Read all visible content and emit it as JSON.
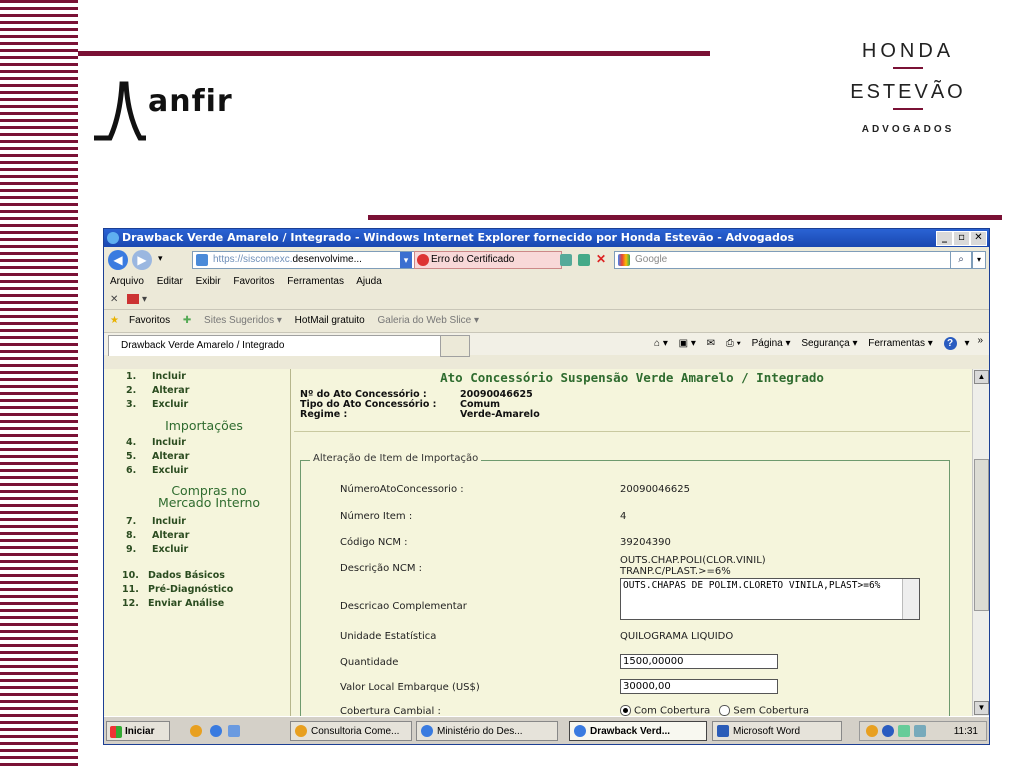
{
  "slide": {
    "logo_left": "anfir",
    "logo_right": {
      "line1": "HONDA",
      "line2": "ESTEVÃO",
      "line3": "ADVOGADOS"
    }
  },
  "window": {
    "title": "Drawback Verde Amarelo / Integrado - Windows Internet Explorer fornecido por Honda Estevão - Advogados",
    "controls": {
      "minimize": "_",
      "maximize": "▫",
      "close": "✕"
    },
    "address": {
      "prefix": "https://siscomexc.",
      "highlight": "desenvolvime...",
      "cert_error": "Erro do Certificado",
      "search_placeholder": "Google"
    },
    "menu": [
      "Arquivo",
      "Editar",
      "Exibir",
      "Favoritos",
      "Ferramentas",
      "Ajuda"
    ],
    "favorites": {
      "label": "Favoritos",
      "items": [
        "Sites Sugeridos ▾",
        "HotMail gratuito",
        "Galeria do Web Slice ▾"
      ]
    },
    "tab_label": "Drawback Verde Amarelo / Integrado",
    "commands": [
      "Página ▾",
      "Segurança ▾",
      "Ferramentas ▾"
    ]
  },
  "nav": {
    "items": [
      {
        "num": "1.",
        "label": "Incluir"
      },
      {
        "num": "2.",
        "label": "Alterar"
      },
      {
        "num": "3.",
        "label": "Excluir"
      },
      {
        "num": "4.",
        "label": "Incluir"
      },
      {
        "num": "5.",
        "label": "Alterar"
      },
      {
        "num": "6.",
        "label": "Excluir"
      },
      {
        "num": "7.",
        "label": "Incluir"
      },
      {
        "num": "8.",
        "label": "Alterar"
      },
      {
        "num": "9.",
        "label": "Excluir"
      },
      {
        "num": "10.",
        "label": "Dados Básicos"
      },
      {
        "num": "11.",
        "label": "Pré-Diagnóstico"
      },
      {
        "num": "12.",
        "label": "Enviar Análise"
      }
    ],
    "section_importacoes": "Importações",
    "section_compras_1": "Compras no",
    "section_compras_2": "Mercado Interno"
  },
  "main": {
    "title": "Ato Concessório Suspensão Verde Amarelo / Integrado",
    "ato_label": "Nº do Ato Concessório :",
    "ato_value": "20090046625",
    "tipo_label": "Tipo do Ato Concessório :",
    "tipo_value": "Comum",
    "regime_label": "Regime :",
    "regime_value": "Verde-Amarelo",
    "legend": "Alteração de Item de Importação",
    "fields": {
      "numero_ato_label": "NúmeroAtoConcessorio :",
      "numero_ato_value": "20090046625",
      "numero_item_label": "Número Item :",
      "numero_item_value": "4",
      "ncm_label": "Código NCM :",
      "ncm_value": "39204390",
      "desc_ncm_label": "Descrição NCM :",
      "desc_ncm_line1": "OUTS.CHAP.POLI(CLOR.VINIL)",
      "desc_ncm_line2": "TRANP.C/PLAST.>=6%",
      "desc_comp_label": "Descricao Complementar",
      "desc_comp_value": "OUTS.CHAPAS DE POLIM.CLORETO VINILA,PLAST>=6%",
      "unidade_label": "Unidade Estatística",
      "unidade_value": "QUILOGRAMA LIQUIDO",
      "quantidade_label": "Quantidade",
      "quantidade_value": "1500,00000",
      "valor_label": "Valor Local Embarque (US$)",
      "valor_value": "30000,00",
      "cobertura_label": "Cobertura Cambial :",
      "cobertura_opt1": "Com Cobertura",
      "cobertura_opt2": "Sem Cobertura"
    }
  },
  "taskbar": {
    "start": "Iniciar",
    "buttons": [
      "Consultoria Come...",
      "Ministério do Des...",
      "Drawback Verd...",
      "Microsoft Word"
    ],
    "clock": "11:31"
  },
  "colors": {
    "accent": "#7a1135",
    "panel_bg": "#f5f5dc",
    "heading_green": "#2f6c2f"
  }
}
